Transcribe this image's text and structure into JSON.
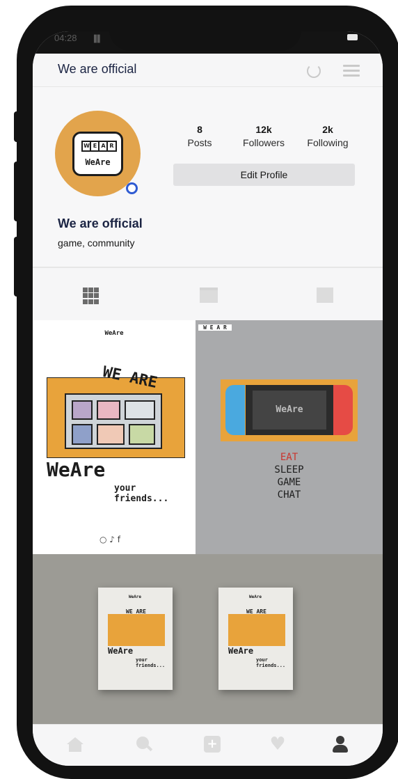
{
  "status": {
    "time": "04:28",
    "signal": "▐▌"
  },
  "header": {
    "title": "We are official"
  },
  "profile": {
    "logo_text": "WeAre",
    "puzzle_letters": [
      "W",
      "E",
      "A",
      "R"
    ],
    "stats": [
      {
        "value": "8",
        "label": "Posts"
      },
      {
        "value": "12k",
        "label": "Followers"
      },
      {
        "value": "2k",
        "label": "Following"
      }
    ],
    "edit_label": "Edit Profile",
    "name": "We are official",
    "bio": "game, community"
  },
  "posts": {
    "post1": {
      "logo": "WeAre",
      "headline": "WE ARE",
      "brand": "WeAre",
      "tagline": "your friends...",
      "socials": "○ ♪ f"
    },
    "post2": {
      "logo": "W E A R",
      "screen_text": "WeAre",
      "motto_line1": "EAT",
      "motto_line2": "SLEEP",
      "motto_line3": "GAME",
      "motto_line4": "CHAT"
    },
    "post3": {
      "poster_headline": "WE ARE",
      "poster_brand": "WeAre",
      "poster_tagline": "your friends..."
    }
  },
  "nav": {
    "add": "+",
    "heart": "♥"
  },
  "colors": {
    "accent": "#e2a44c",
    "title": "#1b2443",
    "online_ring": "#2f5bd2"
  }
}
